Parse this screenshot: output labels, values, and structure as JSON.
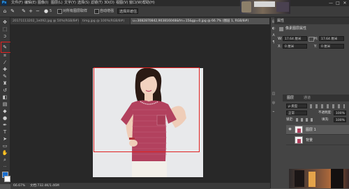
{
  "menubar": {
    "logo": "Ps",
    "items": [
      "文件(F)",
      "编辑(E)",
      "图像(I)",
      "图层(L)",
      "文字(Y)",
      "选择(S)",
      "滤镜(T)",
      "3D(D)",
      "视图(V)",
      "窗口(W)",
      "帮助(H)"
    ],
    "window_controls": [
      "—",
      "□",
      "✕"
    ]
  },
  "optbar": {
    "home_icon": "⌂",
    "brush_icon": "✎",
    "plus_label": "+",
    "minus_label": "−",
    "checkbox_label": "对所有图层取样",
    "enhance_label": "自动增强",
    "refine_label": "选择并遮住...",
    "size_value": "5"
  },
  "tabs": [
    {
      "label": "20171113202_1e092.jpg @ 50%(RGB/8#)",
      "active": false
    },
    {
      "label": "timg.jpg @ 100%(RGB/8#)",
      "active": false
    },
    {
      "label": "u=3082870842,903816048&fm=15&gp=0.jpg @ 66.7% (图层 1, RGB/8#)",
      "active": true
    }
  ],
  "tools": [
    {
      "name": "move-tool",
      "glyph": "✥"
    },
    {
      "name": "marquee-tool",
      "glyph": "⬚"
    },
    {
      "name": "lasso-tool",
      "glyph": "ↄ"
    },
    {
      "name": "quick-selection-tool",
      "glyph": "✎"
    },
    {
      "name": "crop-tool",
      "glyph": "⌗"
    },
    {
      "name": "eyedropper-tool",
      "glyph": "⁄"
    },
    {
      "name": "healing-brush-tool",
      "glyph": "✚"
    },
    {
      "name": "brush-tool",
      "glyph": "✎"
    },
    {
      "name": "clone-stamp-tool",
      "glyph": "♜"
    },
    {
      "name": "history-brush-tool",
      "glyph": "↺"
    },
    {
      "name": "eraser-tool",
      "glyph": "◧"
    },
    {
      "name": "gradient-tool",
      "glyph": "▤"
    },
    {
      "name": "blur-tool",
      "glyph": "◆"
    },
    {
      "name": "dodge-tool",
      "glyph": "●"
    },
    {
      "name": "pen-tool",
      "glyph": "✒"
    },
    {
      "name": "type-tool",
      "glyph": "T"
    },
    {
      "name": "path-selection-tool",
      "glyph": "➤"
    },
    {
      "name": "shape-tool",
      "glyph": "▭"
    },
    {
      "name": "hand-tool",
      "glyph": "✋"
    },
    {
      "name": "zoom-tool",
      "glyph": "⌕"
    },
    {
      "name": "more-tools",
      "glyph": "···"
    }
  ],
  "colors": {
    "foreground": "#1a6fd0",
    "background": "#ffffff",
    "highlight": "#e02020"
  },
  "statusbar": {
    "zoom": "66.67%",
    "doc_info": "文档:732.4K/1.46M"
  },
  "properties": {
    "title": "属性",
    "subtitle": "像素图层属性",
    "w_label": "W:",
    "w_value": "17.64 厘米",
    "h_label": "H:",
    "h_value": "17.64 厘米",
    "x_label": "X:",
    "x_value": "0 厘米",
    "y_label": "Y:",
    "y_value": "0 厘米"
  },
  "layers": {
    "tab_layers": "图层",
    "tab_channels": "通道",
    "kind_filter": "ρ 类型",
    "blend_mode": "正常",
    "opacity_label": "不透明度:",
    "opacity_value": "100%",
    "lock_label": "锁定:",
    "fill_label": "填充:",
    "fill_value": "100%",
    "items": [
      {
        "name": "图层 1",
        "active": true
      },
      {
        "name": "背景",
        "active": false
      }
    ]
  }
}
